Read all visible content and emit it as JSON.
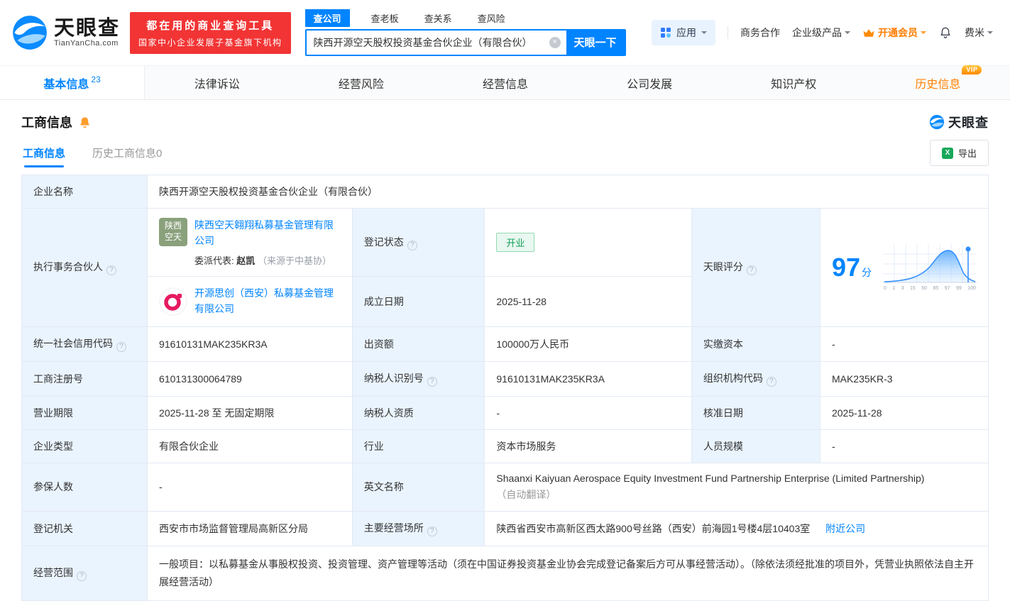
{
  "brand": {
    "name": "天眼查",
    "domain": "TianYanCha.com",
    "banner_line1": "都在用的商业查询工具",
    "banner_line2": "国家中小企业发展子基金旗下机构"
  },
  "search": {
    "tabs": [
      {
        "label": "查公司",
        "active": true
      },
      {
        "label": "查老板",
        "active": false
      },
      {
        "label": "查关系",
        "active": false
      },
      {
        "label": "查风险",
        "active": false
      }
    ],
    "value": "陕西开源空天股权投资基金合伙企业（有限合伙）",
    "button_label": "天眼一下"
  },
  "topnav": {
    "apps_label": "应用",
    "cooperation_label": "商务合作",
    "products_label": "企业级产品",
    "vip_label": "开通会员",
    "user_label": "费米"
  },
  "nav_tabs": {
    "items": [
      {
        "label": "基本信息",
        "count": "23",
        "active": true
      },
      {
        "label": "法律诉讼"
      },
      {
        "label": "经营风险"
      },
      {
        "label": "经营信息"
      },
      {
        "label": "公司发展"
      },
      {
        "label": "知识产权"
      },
      {
        "label": "历史信息",
        "badge": "VIP"
      }
    ]
  },
  "section": {
    "title": "工商信息",
    "subtab_current": "工商信息",
    "subtab_history": "历史工商信息0",
    "export_label": "导出",
    "brand_watermark": "天眼查"
  },
  "info": {
    "company_name_label": "企业名称",
    "company_name": "陕西开源空天股权投资基金合伙企业（有限合伙）",
    "partner_label": "执行事务合伙人",
    "partner1": {
      "logo_line1": "陕西",
      "logo_line2": "空天",
      "name": "陕西空天翱翔私募基金管理有限公司",
      "rep_label": "委派代表:",
      "rep_name": "赵凯",
      "rep_source": "（来源于中基协）"
    },
    "partner2": {
      "name": "开源思创（西安）私募基金管理有限公司"
    },
    "reg_status_label": "登记状态",
    "reg_status": "开业",
    "established_label": "成立日期",
    "established": "2025-11-28",
    "score_label": "天眼评分",
    "score": "97",
    "score_unit": "分",
    "score_axis": [
      "0",
      "1",
      "3",
      "15",
      "50",
      "85",
      "97",
      "99",
      "100"
    ],
    "credit_code_label": "统一社会信用代码",
    "credit_code": "91610131MAK235KR3A",
    "capital_label": "出资额",
    "capital": "100000万人民币",
    "paid_capital_label": "实缴资本",
    "paid_capital": "-",
    "reg_number_label": "工商注册号",
    "reg_number": "610131300064789",
    "tax_id_label": "纳税人识别号",
    "tax_id": "91610131MAK235KR3A",
    "org_code_label": "组织机构代码",
    "org_code": "MAK235KR-3",
    "term_label": "营业期限",
    "term": "2025-11-28 至 无固定期限",
    "tax_quality_label": "纳税人资质",
    "tax_quality": "-",
    "approve_date_label": "核准日期",
    "approve_date": "2025-11-28",
    "company_type_label": "企业类型",
    "company_type": "有限合伙企业",
    "industry_label": "行业",
    "industry": "资本市场服务",
    "staff_size_label": "人员规模",
    "staff_size": "-",
    "insured_label": "参保人数",
    "insured": "-",
    "english_name_label": "英文名称",
    "english_name": "Shaanxi Kaiyuan Aerospace Equity Investment Fund Partnership Enterprise (Limited Partnership)",
    "english_name_note": "（自动翻译）",
    "reg_authority_label": "登记机关",
    "reg_authority": "西安市市场监督管理局高新区分局",
    "address_label": "主要经营场所",
    "address": "陕西省西安市高新区西太路900号丝路（西安）前海园1号楼4层10403室",
    "nearby_link": "附近公司",
    "scope_label": "经营范围",
    "scope": "一般项目：以私募基金从事股权投资、投资管理、资产管理等活动（须在中国证券投资基金业协会完成登记备案后方可从事经营活动）。（除依法须经批准的项目外，凭营业执照依法自主开展经营活动）"
  },
  "icons": {
    "logo": "tianyancha-swirl",
    "help": "question-circle",
    "clear": "circle-x",
    "excel": "excel-square",
    "subscribe_bell": "bell-orange",
    "notification_bell": "bell-outline",
    "apps_grid": "grid-2x2",
    "vip_crown": "crown",
    "score_marker": "pin-line"
  },
  "colors": {
    "brand_blue": "#0084ff",
    "banner_red": "#f23434",
    "vip_orange": "#ff8000",
    "status_green": "#0f9e56",
    "label_cell_bg": "#eaf4fe",
    "partner_logo_green": "#8aa17c",
    "partner_logo_pink": "#e61a61"
  }
}
